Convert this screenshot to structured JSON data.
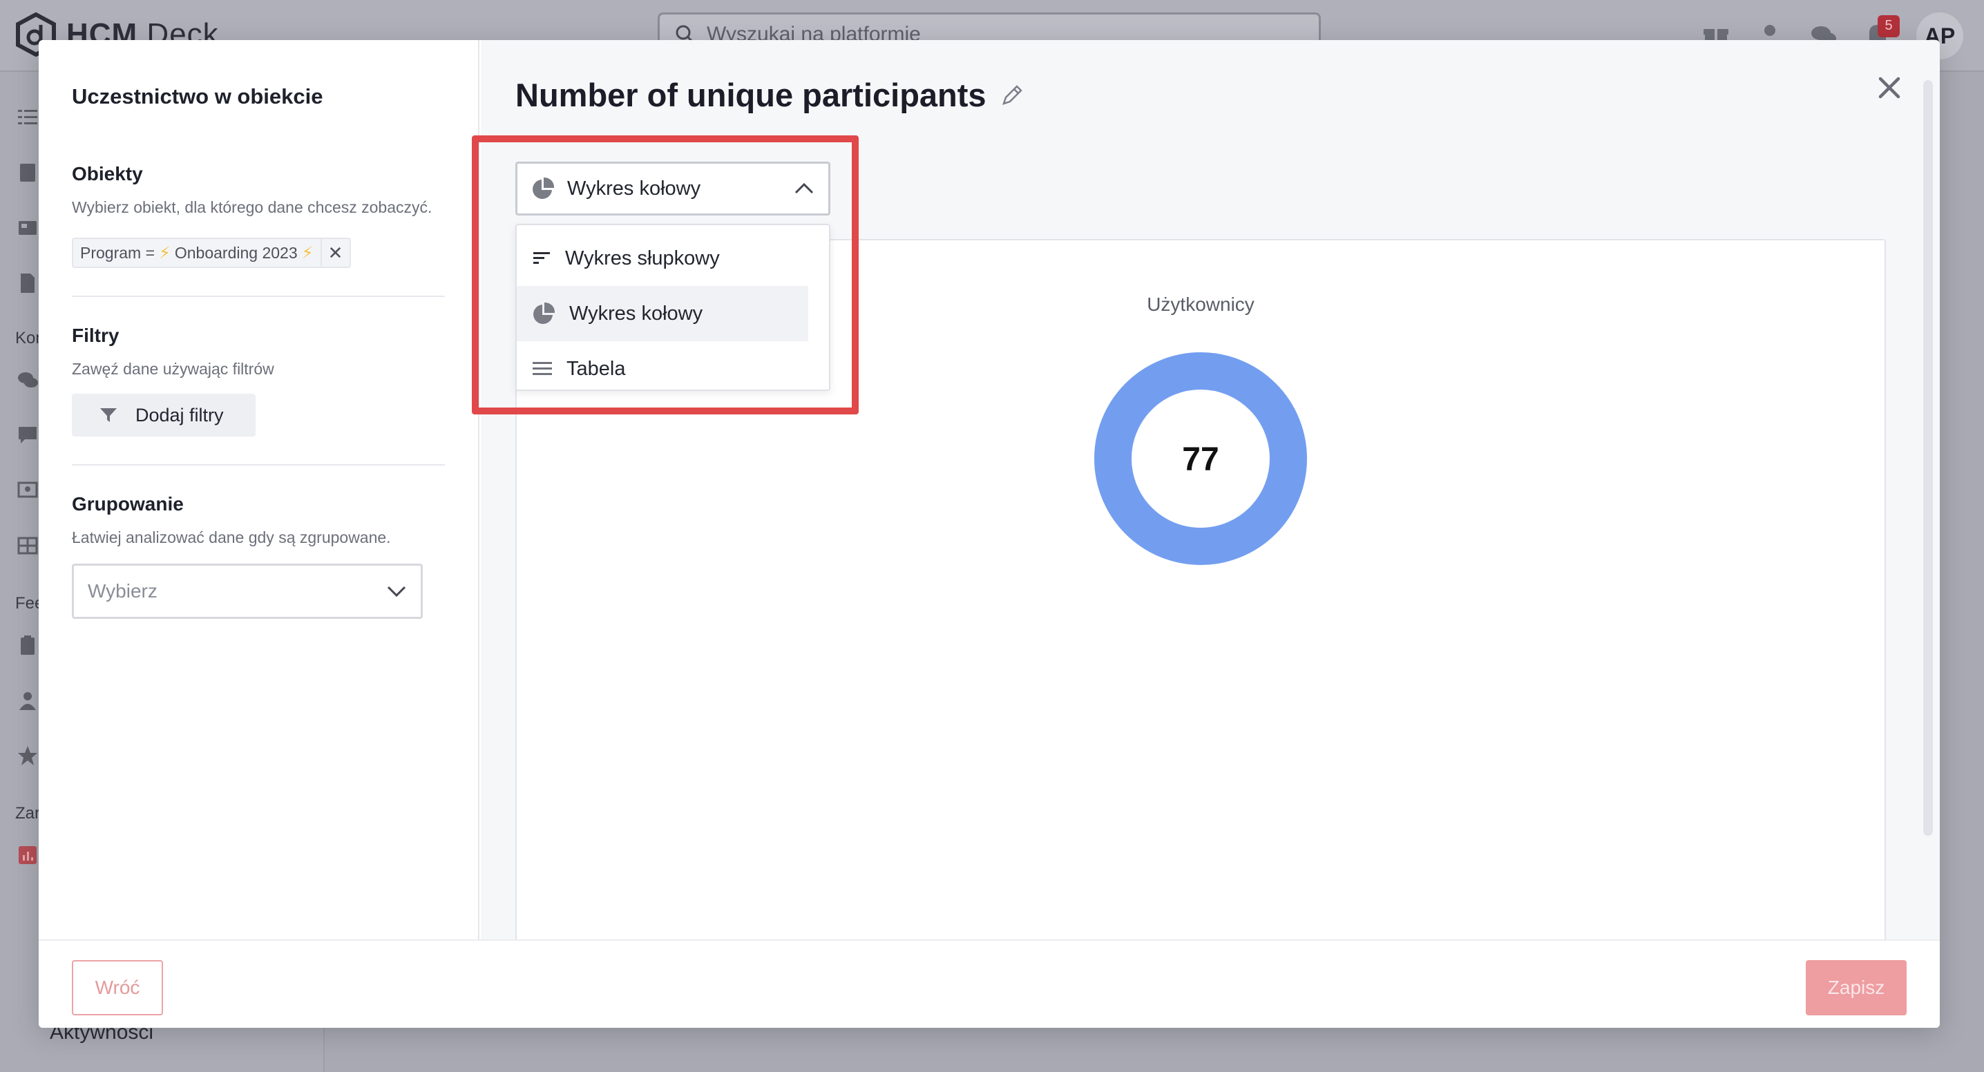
{
  "app": {
    "logo_strong": "HCM",
    "logo_light": " Deck",
    "search_placeholder": "Wyszukaj na platformie",
    "notifications_count": "5",
    "avatar_initials": "AP",
    "sidebar_labels": [
      "Kor",
      "Fee",
      "Zar"
    ],
    "sidebar_bottom": "Aktywności"
  },
  "modal": {
    "left": {
      "title": "Uczestnictwo w obiekcie",
      "objects": {
        "title": "Obiekty",
        "description": "Wybierz obiekt, dla którego dane chcesz zobaczyć.",
        "chip_key": "Program =",
        "chip_value": "Onboarding 2023"
      },
      "filters": {
        "title": "Filtry",
        "description": "Zawęź dane używając filtrów",
        "add_button": "Dodaj filtry"
      },
      "grouping": {
        "title": "Grupowanie",
        "description": "Łatwiej analizować dane gdy są zgrupowane.",
        "select_placeholder": "Wybierz"
      }
    },
    "right": {
      "title": "Number of unique participants",
      "chart_type_selected": "Wykres kołowy",
      "chart_type_options": [
        "Wykres słupkowy",
        "Wykres kołowy",
        "Tabela"
      ],
      "selected_option_index": 1
    },
    "footer": {
      "back_label": "Wróć",
      "save_label": "Zapisz"
    }
  },
  "colors": {
    "accent_red": "#e1484a",
    "donut_blue": "#739ef0",
    "disabled_red": "#ee9da1"
  },
  "chart_data": {
    "type": "pie",
    "title": "Użytkownicy",
    "slices": [
      {
        "label": "",
        "value": 77
      }
    ],
    "center_label": "77"
  }
}
